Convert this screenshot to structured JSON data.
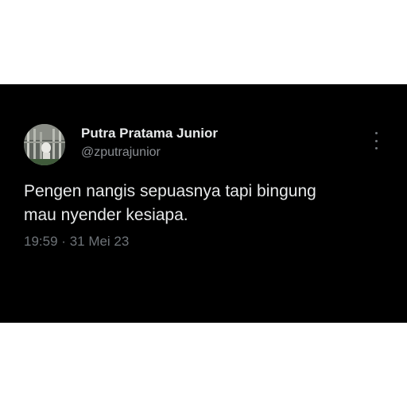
{
  "tweet": {
    "author": {
      "display_name": "Putra Pratama Junior",
      "handle": "@zputrajunior",
      "avatar_icon": "profile-photo"
    },
    "text_line_1": "Pengen nangis sepuasnya tapi bingung",
    "text_line_2": "mau nyender kesiapa.",
    "time": "19:59",
    "separator": "·",
    "date": "31 Mei 23",
    "more_icon": "vertical-ellipsis-icon"
  },
  "colors": {
    "card_background": "#000000",
    "page_background": "#ffffff",
    "primary_text": "#e7e9ea",
    "secondary_text": "#8b8f94"
  }
}
